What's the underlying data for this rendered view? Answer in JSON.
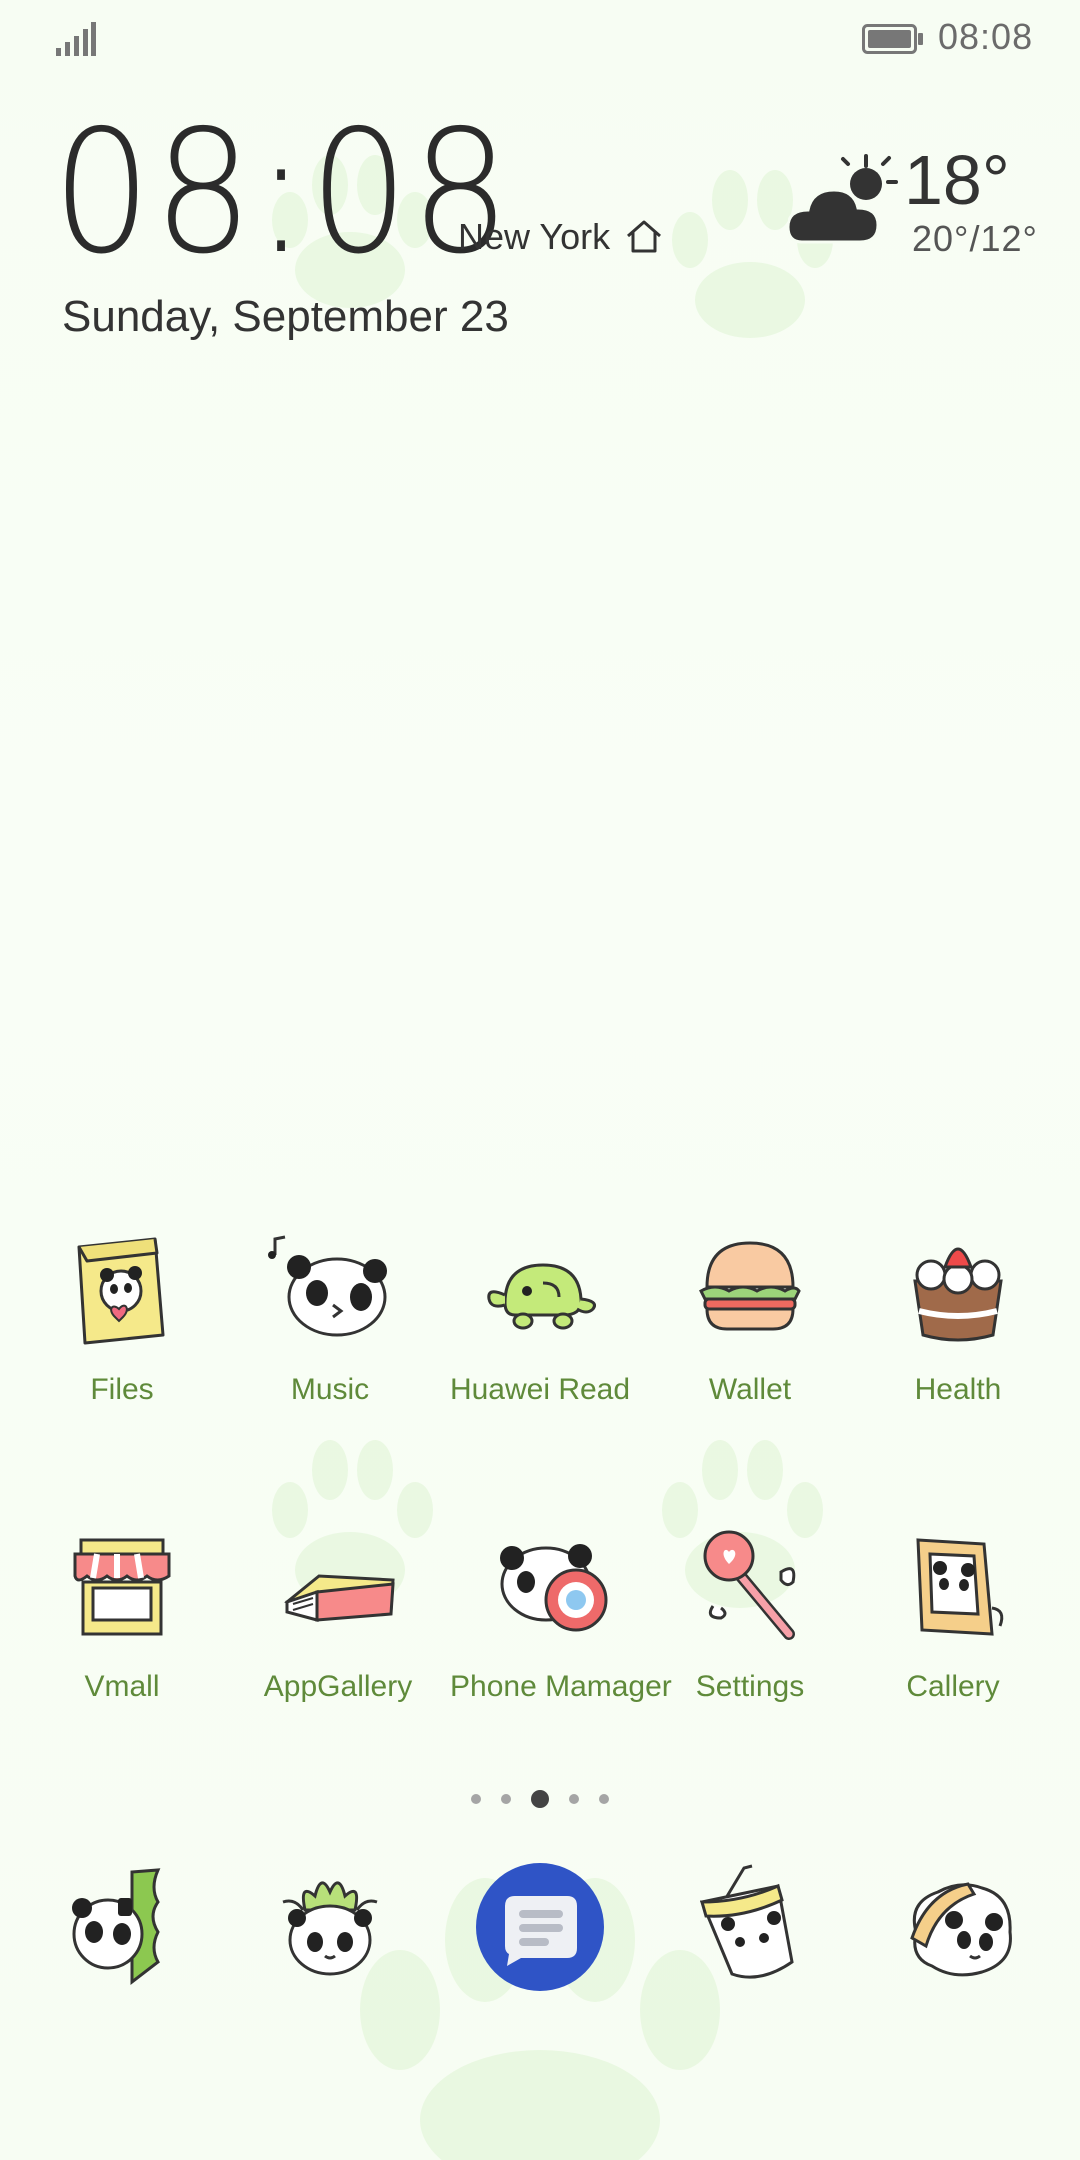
{
  "status_bar": {
    "time": "08:08"
  },
  "clock_widget": {
    "time": "08:08",
    "city": "New York",
    "date": "Sunday, September 23",
    "temperature": "18°",
    "temp_range": "20°/12°"
  },
  "apps": {
    "row1": [
      {
        "label": "Files"
      },
      {
        "label": "Music"
      },
      {
        "label": "Huawei Read"
      },
      {
        "label": "Wallet"
      },
      {
        "label": "Health"
      }
    ],
    "row2": [
      {
        "label": "Vmall"
      },
      {
        "label": "AppGallery"
      },
      {
        "label": "Phone Mamager"
      },
      {
        "label": "Settings"
      },
      {
        "label": "Callery"
      }
    ]
  },
  "page_indicator": {
    "count": 5,
    "active": 3
  },
  "dock": [
    {
      "icon": "phone-panda-icon"
    },
    {
      "icon": "contacts-panda-icon"
    },
    {
      "icon": "messages-icon"
    },
    {
      "icon": "browser-cup-icon"
    },
    {
      "icon": "camera-panda-icon"
    }
  ],
  "colors": {
    "label_green": "#5f8a3a",
    "paw_green": "#dff5d4",
    "messages_blue": "#2f54c6"
  }
}
